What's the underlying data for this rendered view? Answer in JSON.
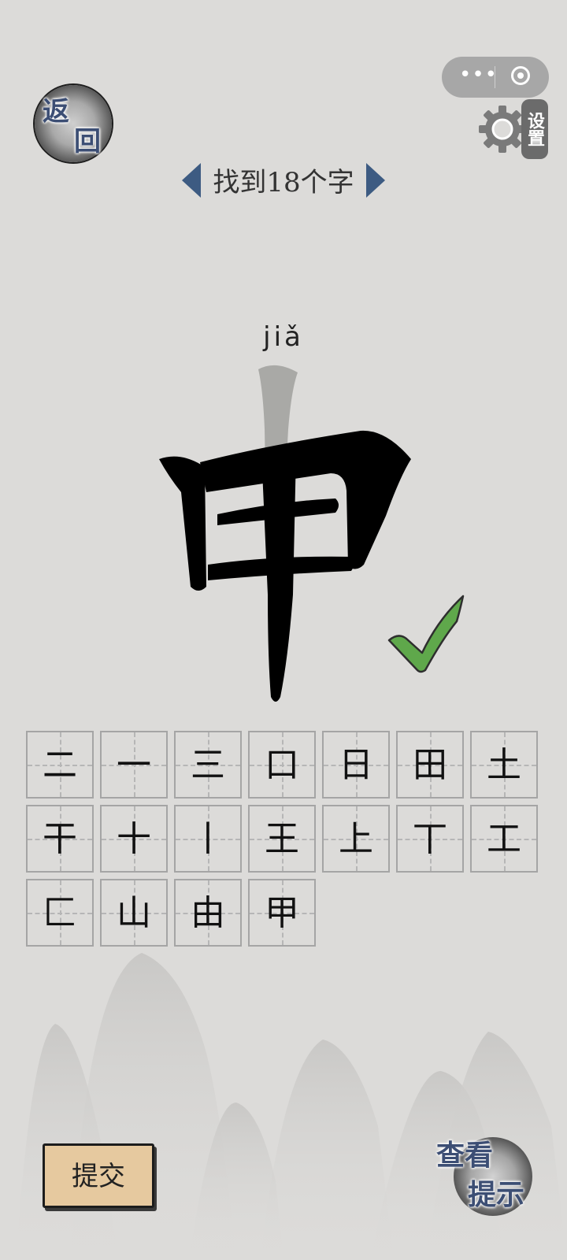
{
  "back_button": {
    "line1": "返",
    "line2": "回"
  },
  "capsule": {
    "more_icon": "more-dots-icon",
    "close_icon": "target-icon"
  },
  "settings": {
    "label": "设置",
    "icon": "gear-icon"
  },
  "header": {
    "title": "找到18个字",
    "prev_icon": "chevron-left-icon",
    "next_icon": "chevron-right-icon"
  },
  "puzzle": {
    "pinyin": "jiǎ",
    "character": "甲",
    "status_icon": "green-check-icon"
  },
  "found_characters": [
    "二",
    "一",
    "三",
    "口",
    "日",
    "田",
    "土",
    "干",
    "十",
    "丨",
    "王",
    "上",
    "丅",
    "工",
    "匚",
    "山",
    "由",
    "甲"
  ],
  "buttons": {
    "submit": "提交",
    "hint_line1": "查看",
    "hint_line2": "提示"
  },
  "colors": {
    "accent_blue": "#3d5b82",
    "check_green": "#5fa84b",
    "submit_bg": "#e6c99f",
    "background": "#dcdbd9"
  }
}
